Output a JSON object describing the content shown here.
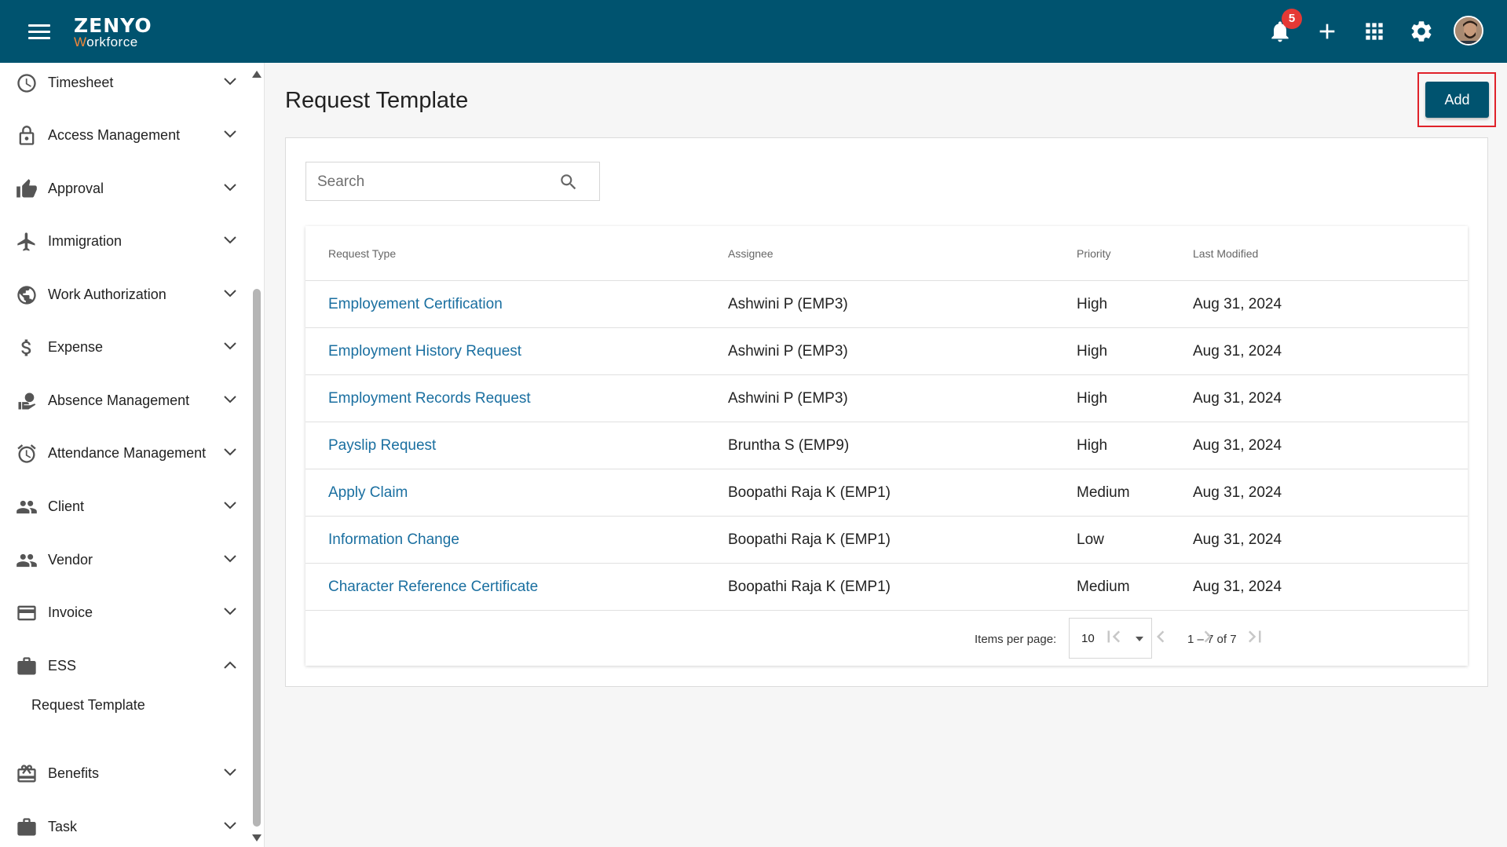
{
  "header": {
    "logo_top": "ZENYO",
    "logo_bottom_first": "W",
    "logo_bottom_rest": "orkforce",
    "notification_count": "5",
    "icons": [
      "menu-icon",
      "bell-icon",
      "plus-icon",
      "apps-grid-icon",
      "gear-icon",
      "user-avatar"
    ]
  },
  "sidebar": {
    "items": [
      {
        "label": "Timesheet",
        "icon": "clock-icon"
      },
      {
        "label": "Access Management",
        "icon": "lock-icon"
      },
      {
        "label": "Approval",
        "icon": "thumbs-up-icon"
      },
      {
        "label": "Immigration",
        "icon": "airplane-icon"
      },
      {
        "label": "Work Authorization",
        "icon": "globe-icon"
      },
      {
        "label": "Expense",
        "icon": "dollar-icon"
      },
      {
        "label": "Absence Management",
        "icon": "person-leave-icon"
      },
      {
        "label": "Attendance Management",
        "icon": "alarm-icon"
      },
      {
        "label": "Client",
        "icon": "people-icon"
      },
      {
        "label": "Vendor",
        "icon": "people-icon"
      },
      {
        "label": "Invoice",
        "icon": "credit-card-icon"
      },
      {
        "label": "ESS",
        "icon": "briefcase-icon"
      },
      {
        "label": "Benefits",
        "icon": "gift-card-icon"
      },
      {
        "label": "Task",
        "icon": "briefcase-icon"
      }
    ],
    "sub_item": "Request Template"
  },
  "main": {
    "title": "Request Template",
    "add_label": "Add",
    "search_placeholder": "Search",
    "columns": [
      "Request Type",
      "Assignee",
      "Priority",
      "Last Modified"
    ],
    "rows": [
      {
        "type": "Employement Certification",
        "assignee": "Ashwini P (EMP3)",
        "priority": "High",
        "modified": "Aug 31, 2024"
      },
      {
        "type": "Employment History Request",
        "assignee": "Ashwini P (EMP3)",
        "priority": "High",
        "modified": "Aug 31, 2024"
      },
      {
        "type": "Employment Records Request",
        "assignee": "Ashwini P (EMP3)",
        "priority": "High",
        "modified": "Aug 31, 2024"
      },
      {
        "type": "Payslip Request",
        "assignee": "Bruntha S (EMP9)",
        "priority": "High",
        "modified": "Aug 31, 2024"
      },
      {
        "type": "Apply Claim",
        "assignee": "Boopathi Raja K (EMP1)",
        "priority": "Medium",
        "modified": "Aug 31, 2024"
      },
      {
        "type": "Information Change",
        "assignee": "Boopathi Raja K (EMP1)",
        "priority": "Low",
        "modified": "Aug 31, 2024"
      },
      {
        "type": "Character Reference Certificate",
        "assignee": "Boopathi Raja K (EMP1)",
        "priority": "Medium",
        "modified": "Aug 31, 2024"
      }
    ],
    "paginator": {
      "items_per_page_label": "Items per page:",
      "items_per_page_value": "10",
      "range": "1 – 7 of 7"
    }
  },
  "colors": {
    "header_bg": "#00536f",
    "link": "#1a6fa0",
    "badge": "#e53935",
    "highlight_border": "#e0222a"
  }
}
